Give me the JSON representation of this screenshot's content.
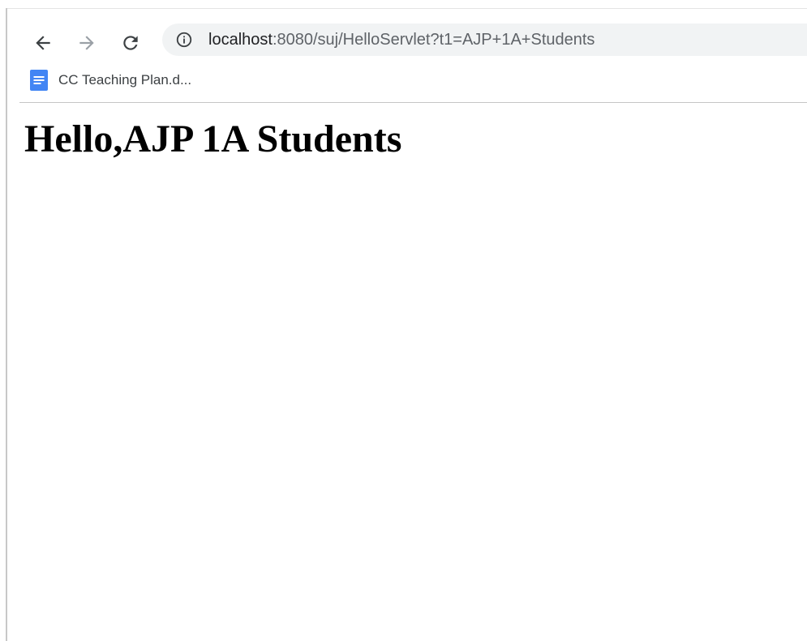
{
  "browser": {
    "nav": {
      "back_icon": "arrow-left-icon",
      "forward_icon": "arrow-right-icon",
      "reload_icon": "reload-icon"
    },
    "address_bar": {
      "info_icon": "info-circle-icon",
      "host": "localhost",
      "path": ":8080/suj/HelloServlet?t1=AJP+1A+Students"
    },
    "bookmarks": [
      {
        "label": "CC Teaching Plan.d...",
        "icon": "google-docs-icon"
      }
    ]
  },
  "page": {
    "heading": "Hello,AJP 1A Students"
  },
  "colors": {
    "omnibox_bg": "#f1f3f4",
    "docs_icon": "#4285f4",
    "active_icon": "#3c4043",
    "disabled_icon": "#9aa0a6"
  }
}
